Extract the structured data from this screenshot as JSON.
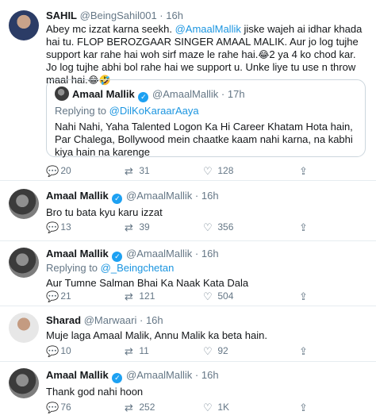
{
  "tweets": [
    {
      "name": "SAHIL",
      "handle": "@BeingSahil001",
      "time": "16h",
      "text_a": "Abey mc izzat karna seekh. ",
      "mention": "@AmaalMallik",
      "text_b": " jiske wajeh ai idhar khada hai tu. FLOP BEROZGAAR SINGER AMAAL MALIK. Aur jo log tujhe support kar rahe hai woh sirf maze le rahe hai.",
      "emoji_1": "😂",
      "text_c": "2 ya 4 ko chod kar. Jo log tujhe abhi bol rahe hai we support u. Unke liye tu use n throw maal hai.",
      "emoji_2": "😂🤣",
      "quote": {
        "name": "Amaal Mallik",
        "handle": "@AmaalMallik",
        "time": "17h",
        "replying_prefix": "Replying to ",
        "replying_to": "@DilKoKaraarAaya",
        "text": "Nahi Nahi, Yaha Talented Logon Ka Hi Career Khatam Hota hain, Par Chalega, Bollywood mein chaatke kaam nahi karna, na kabhi kiya hain na karenge"
      },
      "replies": "20",
      "retweets": "31",
      "likes": "128"
    },
    {
      "name": "Amaal Mallik",
      "handle": "@AmaalMallik",
      "time": "16h",
      "text": "Bro tu bata kyu karu izzat",
      "replies": "13",
      "retweets": "39",
      "likes": "356"
    },
    {
      "name": "Amaal Mallik",
      "handle": "@AmaalMallik",
      "time": "16h",
      "replying_prefix": "Replying to ",
      "replying_to": "@_Beingchetan",
      "text": "Aur Tumne Salman Bhai Ka Naak Kata Dala",
      "replies": "21",
      "retweets": "121",
      "likes": "504"
    },
    {
      "name": "Sharad",
      "handle": "@Marwaari",
      "time": "16h",
      "text": "Muje laga Amaal Malik, Annu Malik ka beta hain.",
      "replies": "10",
      "retweets": "11",
      "likes": "92"
    },
    {
      "name": "Amaal Mallik",
      "handle": "@AmaalMallik",
      "time": "16h",
      "text": "Thank god nahi hoon",
      "replies": "76",
      "retweets": "252",
      "likes": "1K"
    }
  ],
  "separator": "·",
  "icons": {
    "reply": "reply-icon",
    "retweet": "retweet-icon",
    "like": "heart-icon",
    "share": "share-icon",
    "verified": "verified-badge-icon"
  },
  "colors": {
    "link": "#1b95e0",
    "muted": "#657786",
    "verified": "#1da1f2",
    "border": "#e6ecf0"
  }
}
